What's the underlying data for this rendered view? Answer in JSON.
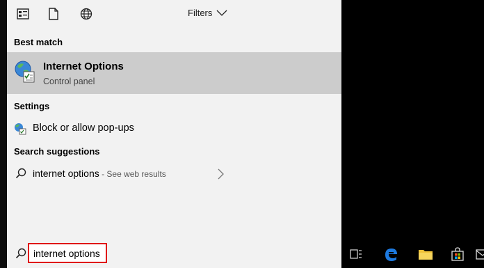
{
  "toolbar": {
    "filters_label": "Filters"
  },
  "best_match": {
    "heading": "Best match",
    "title": "Internet Options",
    "subtitle": "Control panel"
  },
  "settings": {
    "heading": "Settings",
    "items": [
      {
        "label": "Block or allow pop-ups"
      }
    ]
  },
  "suggestions": {
    "heading": "Search suggestions",
    "items": [
      {
        "query": "internet options",
        "hint": " - See web results"
      }
    ]
  },
  "search": {
    "value": "internet options"
  },
  "colors": {
    "panel_bg": "#f2f2f2",
    "selected_bg": "#cccccc",
    "highlight_border": "#e01010",
    "taskbar_bg": "#000000"
  }
}
